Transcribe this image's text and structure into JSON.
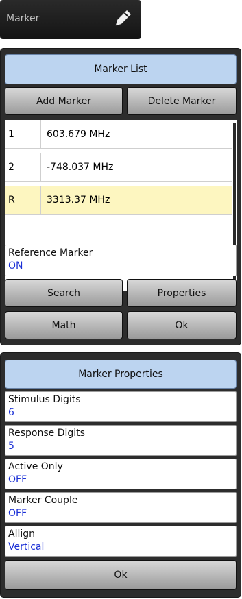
{
  "header": {
    "title": "Marker",
    "edit_icon": "pencil-icon"
  },
  "marker_list": {
    "title": "Marker List",
    "add_label": "Add Marker",
    "delete_label": "Delete Marker",
    "rows": [
      {
        "index": "1",
        "value": "603.679 MHz",
        "selected": false
      },
      {
        "index": "2",
        "value": "-748.037 MHz",
        "selected": false
      },
      {
        "index": "R",
        "value": "3313.37 MHz",
        "selected": true
      }
    ],
    "reference": {
      "label": "Reference Marker",
      "value": "ON"
    },
    "search_label": "Search",
    "properties_label": "Properties",
    "math_label": "Math",
    "ok_label": "Ok"
  },
  "marker_properties": {
    "title": "Marker Properties",
    "fields": [
      {
        "label": "Stimulus Digits",
        "value": "6"
      },
      {
        "label": "Response Digits",
        "value": "5"
      },
      {
        "label": "Active Only",
        "value": "OFF"
      },
      {
        "label": "Marker Couple",
        "value": "OFF"
      },
      {
        "label": "Allign",
        "value": "Vertical"
      }
    ],
    "ok_label": "Ok"
  },
  "colors": {
    "title_bg": "#bcd4f0",
    "value_text": "#1a2fd6",
    "selected_row": "#fdf6c0"
  }
}
